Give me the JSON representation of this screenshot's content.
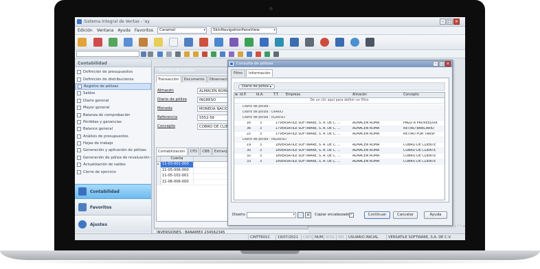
{
  "app": {
    "title": "Sistema Integral de Ventas - 'ay"
  },
  "menu": {
    "items": [
      "Edición",
      "Ventana",
      "Ayuda",
      "Favoritos"
    ],
    "combo1": "Caramel",
    "combo2": "SkinNavigationPaneView"
  },
  "nav": {
    "header": "Contabilidad",
    "items": [
      {
        "label": "Definición de presupuestos"
      },
      {
        "label": "Definición de distribuciones"
      },
      {
        "label": "Registro de pólizas"
      },
      {
        "label": "Saldos"
      },
      {
        "label": "Diario general"
      },
      {
        "label": "Mayor general"
      },
      {
        "label": "Balanza de comprobación"
      },
      {
        "label": "Pérdidas y ganancias"
      },
      {
        "label": "Balance general"
      },
      {
        "label": "Análisis de presupuestos"
      },
      {
        "label": "Hojas de trabajo"
      },
      {
        "label": "Generación y aplicación de pólizas"
      },
      {
        "label": "Generación de póliza de revaluación ca..."
      },
      {
        "label": "Actualización de saldos"
      },
      {
        "label": "Cierre de ejercicio"
      }
    ],
    "buttons": {
      "contabilidad": "Contabilidad",
      "favoritos": "Favoritos",
      "ajustes": "Ajustes"
    }
  },
  "registro": {
    "title": "Registro de pólizas",
    "tabs": [
      "Transacción",
      "Documento",
      "Observaciones"
    ],
    "fields": [
      {
        "label": "Almacén",
        "value": "ALMACEN ROMA"
      },
      {
        "label": "Diario de póliza",
        "value": "INGRESO"
      },
      {
        "label": "Moneda",
        "value": "MONEDA NACIONAL"
      },
      {
        "label": "Referencia",
        "value": "5552-56"
      },
      {
        "label": "Concepto",
        "value": "COBRO DE CLIENTE"
      }
    ],
    "subtabs": [
      "Contabilización",
      "CFD",
      "CBB",
      "Extranjero"
    ],
    "grid": {
      "headers": [
        "Cuenta",
        "Cento ..."
      ],
      "rows": [
        "11-03-001-000",
        "21-05-006-000",
        "11-05-102-001",
        "21-06-006-000"
      ]
    },
    "footer": "INVERSIONES : BANAMEX 234562345"
  },
  "dialog": {
    "title": "Consulta de pólizas",
    "tabs": [
      "Filtro",
      "Información"
    ],
    "groupby": "Diario de póliza",
    "headers": [
      "Id.P.",
      "Id.A.",
      "T.T.",
      "Empresa",
      "Almacén",
      "Concepto"
    ],
    "filter_hint": "De un clic aquí para definir un filtro",
    "groups": [
      {
        "label": "Diario de póliza :",
        "rows": []
      },
      {
        "label": "Diario de póliza : DIARIO",
        "rows": []
      },
      {
        "label": "Diario de póliza : EGRESO",
        "rows": [
          {
            "idp": "16",
            "ida": "3",
            "tt": "17",
            "empresa": "VERSATILE SOFTWARE, S. A. DE C. ...",
            "almacen": "ALMACEN ROMA",
            "concepto": "PAGO A PROVEEDOR"
          },
          {
            "idp": "36",
            "ida": "3",
            "tt": "17",
            "empresa": "VERSATILE SOFTWARE, S. A. DE C. ...",
            "almacen": "ALMACEN ROMA",
            "concepto": "RETIRO BANCARIO"
          },
          {
            "idp": "22",
            "ida": "3",
            "tt": "17",
            "empresa": "VERSATILE SOFTWARE, S. A. DE C. ...",
            "almacen": "ALMACEN ROMA",
            "concepto": "RETIRO POR TRASP"
          }
        ]
      },
      {
        "label": "Diario de póliza : INGRESO",
        "rows": [
          {
            "idp": "19",
            "ida": "3",
            "tt": "18",
            "empresa": "VERSATILE SOFTWARE, S. A. DE C. ...",
            "almacen": "ALMACEN ROMA",
            "concepto": "COBRO DE CLIENTE"
          },
          {
            "idp": "30",
            "ida": "3",
            "tt": "18",
            "empresa": "VERSATILE SOFTWARE, S. A. DE C. ...",
            "almacen": "ALMACEN ROMA",
            "concepto": "COBRO DE CLIENTE"
          },
          {
            "idp": "32",
            "ida": "3",
            "tt": "18",
            "empresa": "VERSATILE SOFTWARE, S. A. DE C. ...",
            "almacen": "ALMACEN ROMA",
            "concepto": "COBRO DE CLIENTE"
          },
          {
            "idp": "33",
            "ida": "3",
            "tt": "18",
            "empresa": "VERSATILE SOFTWARE, S. A. DE C. ...",
            "almacen": "ALMACEN ROMA",
            "concepto": "COBRO DE CLIENTE"
          }
        ]
      }
    ],
    "footer": {
      "design_label": "Diseño",
      "copy_headers": "Copiar encabezados",
      "continue": "Continuar",
      "cancel": "Cancelar",
      "help": "Ayuda"
    }
  },
  "statusbar": {
    "user_code": "CINTTR01C",
    "date": "19/07/2021",
    "caps": "CAPS",
    "num": "NUM",
    "scrl": "SCRL",
    "ins": "INS",
    "user": "USUARIO INICIAL",
    "company": "VERSATILE SOFTWARE, S.A. DE C.V."
  },
  "watermark": "softwa",
  "colors": {
    "accent": "#3875d7",
    "selected_bg": "#cfe0f7",
    "title_bar": "#7b97bf",
    "nav_active": "#7cc3f0"
  }
}
